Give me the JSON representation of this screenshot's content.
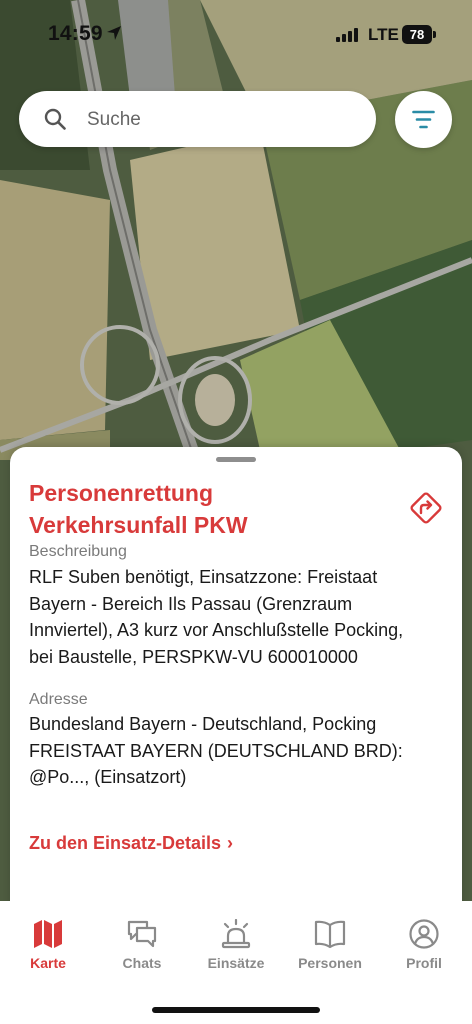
{
  "status_bar": {
    "time": "14:59",
    "network": "LTE",
    "battery": "78"
  },
  "search": {
    "placeholder": "Suche"
  },
  "colors": {
    "accent": "#d83a3a",
    "inactive": "#8a8a8a",
    "map_field": "#a8a07a"
  },
  "icons": {
    "search": "search-icon",
    "filter": "filter-icon",
    "route": "route-icon",
    "location": "location-arrow-icon"
  },
  "incident": {
    "title_line1": "Personenrettung",
    "title_line2": "Verkehrsunfall PKW",
    "description_label": "Beschreibung",
    "description_lines": [
      "RLF Suben benötigt, Einsatzzone: Freistaat",
      "Bayern - Bereich Ils Passau (Grenzraum",
      "Innviertel), A3 kurz vor Anschlußstelle Pocking,",
      "bei Baustelle, PERSPKW-VU 600010000"
    ],
    "address_label": "Adresse",
    "address_lines": [
      "Bundesland Bayern - Deutschland, Pocking",
      "FREISTAAT BAYERN (DEUTSCHLAND BRD):",
      "@Po..., (Einsatzort)"
    ],
    "details_link": "Zu den Einsatz-Details"
  },
  "tabs": [
    {
      "label": "Karte",
      "icon": "map-icon",
      "active": true
    },
    {
      "label": "Chats",
      "icon": "chat-icon",
      "active": false
    },
    {
      "label": "Einsätze",
      "icon": "siren-icon",
      "active": false
    },
    {
      "label": "Personen",
      "icon": "book-icon",
      "active": false
    },
    {
      "label": "Profil",
      "icon": "profile-icon",
      "active": false
    }
  ]
}
